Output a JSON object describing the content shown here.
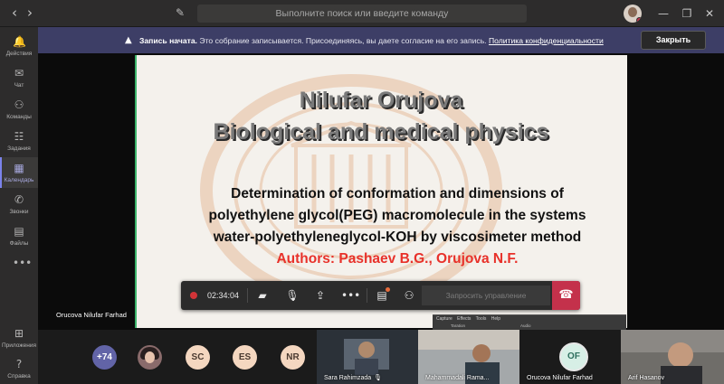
{
  "titlebar": {
    "back_icon": "‹",
    "forward_icon": "›",
    "compose_icon": "✎",
    "search_placeholder": "Выполните поиск или введите команду",
    "minimize_icon": "—",
    "restore_icon": "❐",
    "close_icon": "✕"
  },
  "rail": {
    "items": [
      {
        "icon": "🔔",
        "label": "Действия"
      },
      {
        "icon": "✉",
        "label": "Чат"
      },
      {
        "icon": "⚇",
        "label": "Команды"
      },
      {
        "icon": "☷",
        "label": "Задания"
      },
      {
        "icon": "▦",
        "label": "Календарь"
      },
      {
        "icon": "✆",
        "label": "Звонки"
      },
      {
        "icon": "▤",
        "label": "Файлы"
      },
      {
        "icon": "•••",
        "label": ""
      }
    ],
    "bottom": [
      {
        "icon": "⊞",
        "label": "Приложения"
      },
      {
        "icon": "?",
        "label": "Справка"
      }
    ]
  },
  "banner": {
    "warn_icon": "▲",
    "bold": "Запись начата.",
    "text": " Это собрание записывается. Присоединяясь, вы даете согласие на его запись. ",
    "link": "Политика конфиденциальности",
    "close_label": "Закрыть"
  },
  "slide": {
    "name": "Nilufar Orujova",
    "dept": "Biological and medical physics",
    "line1": "Determination of conformation and dimensions of",
    "line2": "polyethylene glycol(PEG) macromolecule in the systems",
    "line3": "water-polyethyleneglycol-KOH by viscosimeter method",
    "authors": "Authors: Pashaev B.G., Orujova N.F."
  },
  "presenter_name": "Orucova Nilufar Farhad",
  "controls": {
    "timer": "02:34:04",
    "camera_icon": "▰",
    "mic_icon": "🎙",
    "share_icon": "⇪",
    "more_icon": "•••",
    "chat_icon": "▤",
    "people_icon": "⚇",
    "request_label": "Запросить управление",
    "hangup_icon": "☎"
  },
  "capture_window": {
    "menu": "Capture Effects Tools Help",
    "sub": "Taration Audio"
  },
  "participants": {
    "more": "+74",
    "initials": [
      "SC",
      "ES",
      "NR"
    ],
    "tiles": [
      {
        "name": "Sara Rahimzada"
      },
      {
        "name": "Mahammadali Rama..."
      },
      {
        "name": "Orucova Nilufar Farhad",
        "initials": "OF"
      },
      {
        "name": "Arif Hasanov"
      }
    ]
  }
}
